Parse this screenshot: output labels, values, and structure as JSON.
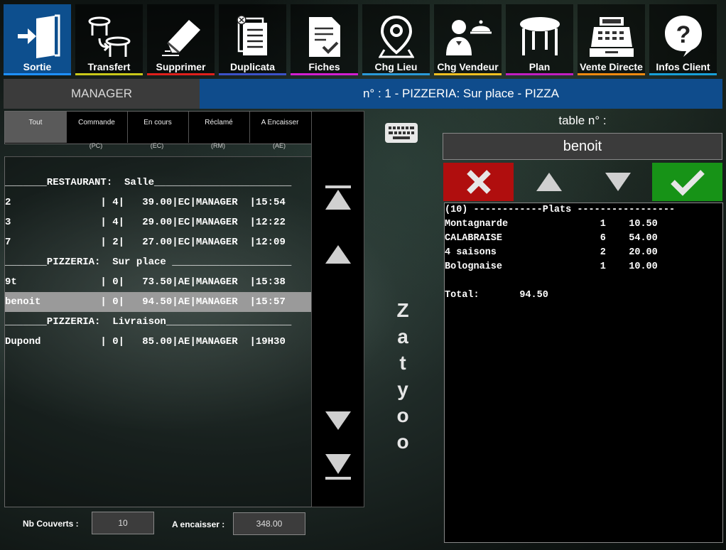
{
  "toolbar": {
    "buttons": [
      {
        "label": "Sortie",
        "icon": "exit-door-icon",
        "color": "#1e90ff"
      },
      {
        "label": "Transfert",
        "icon": "transfer-tables-icon",
        "color": "#c9c91a"
      },
      {
        "label": "Supprimer",
        "icon": "eraser-icon",
        "color": "#e0201c"
      },
      {
        "label": "Duplicata",
        "icon": "duplicate-document-icon",
        "color": "#3c52c8"
      },
      {
        "label": "Fiches",
        "icon": "checklist-icon",
        "color": "#d21ed2"
      },
      {
        "label": "Chg Lieu",
        "icon": "location-pin-icon",
        "color": "#2a9ad8"
      },
      {
        "label": "Chg Vendeur",
        "icon": "waiter-icon",
        "color": "#f0c020"
      },
      {
        "label": "Plan",
        "icon": "table-icon",
        "color": "#c21ec2"
      },
      {
        "label": "Vente Directe",
        "icon": "cash-register-icon",
        "color": "#f08a10"
      },
      {
        "label": "Infos Client",
        "icon": "question-bubble-icon",
        "color": "#18a0d8"
      }
    ]
  },
  "header": {
    "user": "MANAGER",
    "order_info": "n° : 1 - PIZZERIA: Sur place  - PIZZA"
  },
  "filters": {
    "tabs": [
      {
        "label": "Tout",
        "sub": ""
      },
      {
        "label": "Commande",
        "sub": "(PC)"
      },
      {
        "label": "En cours",
        "sub": "(EC)"
      },
      {
        "label": "Réclamé",
        "sub": "(RM)"
      },
      {
        "label": "A Encaisser",
        "sub": "(AE)"
      }
    ],
    "active": "Tout"
  },
  "orders": {
    "lines": [
      {
        "kind": "section",
        "text": "_______RESTAURANT:  Salle_______________________"
      },
      {
        "kind": "order",
        "text": "2               | 4|   39.00|EC|MANAGER  |15:54"
      },
      {
        "kind": "order",
        "text": "3               | 4|   29.00|EC|MANAGER  |12:22"
      },
      {
        "kind": "order",
        "text": "7               | 2|   27.00|EC|MANAGER  |12:09"
      },
      {
        "kind": "section",
        "text": "_______PIZZERIA:  Sur place ____________________"
      },
      {
        "kind": "order",
        "text": "9t              | 0|   73.50|AE|MANAGER  |15:38"
      },
      {
        "kind": "order",
        "text": "benoit          | 0|   94.50|AE|MANAGER  |15:57",
        "selected": true
      },
      {
        "kind": "section",
        "text": "_______PIZZERIA:  Livraison_____________________"
      },
      {
        "kind": "order",
        "text": "Dupond          | 0|   85.00|AE|MANAGER  |19H30"
      }
    ]
  },
  "brand": {
    "letters": [
      "Z",
      "a",
      "t",
      "y",
      "o",
      "o"
    ]
  },
  "footer": {
    "covers_label": "Nb Couverts :",
    "covers_value": "10",
    "to_cash_label": "A encaisser :",
    "to_cash_value": "348.00"
  },
  "detail": {
    "table_label": "table  n° :",
    "table_name": "benoit",
    "ticket_lines": [
      "(10) ------------Plats -----------------",
      "Montagnarde                1    10.50",
      "CALABRAISE                 6    54.00",
      "4 saisons                  2    20.00",
      "Bolognaise                 1    10.00",
      "",
      "Total:       94.50"
    ]
  },
  "colors": {
    "header_blue": "#0f4c8c",
    "cancel_red": "#b00e0e",
    "confirm_green": "#179317",
    "selected_row": "#9a9a9a"
  }
}
